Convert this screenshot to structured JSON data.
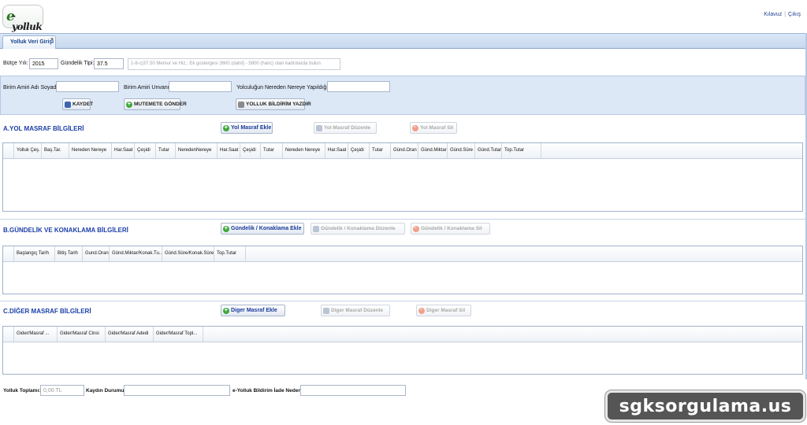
{
  "header": {
    "logo_e": "e",
    "logo_text": "-yolluk",
    "links": [
      "Kılavuz",
      "Çıkış"
    ],
    "link_sep": "|"
  },
  "tab": {
    "label": "Yolluk Veri Girişi",
    "close": "×"
  },
  "form_top": {
    "budget_year_label": "Bütçe Yılı:",
    "budget_year_value": "2015",
    "daily_type_label": "Gündelik Tipi:",
    "daily_type_value": "37.5",
    "info_text": "1-8-c)37.50 Memur ve Hiz.; Ek gostergesi 3600 (dahil) - 5800 (haric) olan kadrolarda bulun"
  },
  "panel": {
    "supervisor_name_label": "Birim Amiri Adı Soyadı:",
    "supervisor_name_value": "",
    "supervisor_title_label": "Birim Amiri Unvanı:",
    "supervisor_title_value": "",
    "route_label": "Yolculuğun Nereden Nereye Yapıldığı:",
    "route_value": "",
    "save_label": "KAYDET",
    "send_label": "MUTEMETE GÖNDER",
    "print_label": "YOLLUK BİLDİRİM YAZDIR"
  },
  "section_a": {
    "title": "A.YOL MASRAF BİLGİLERİ",
    "add_label": "Yol Masraf Ekle",
    "edit_label": "Yol Masraf Düzenle",
    "delete_label": "Yol Masraf Sil",
    "columns": [
      "Yolluk Çeş.",
      "Baş.Tar.",
      "Nereden Nereye",
      "Har.Saat",
      "Çeşidi",
      "Tutar",
      "NeredenNereye",
      "Har.Saat",
      "Çeşidi",
      "Tutar",
      "Nereden Nereye",
      "Har.Saat",
      "Çeşidi",
      "Tutar",
      "Günd.Oran",
      "Günd.Miktar",
      "Günd.Süre",
      "Günd.Tutar",
      "Top.Tutar"
    ]
  },
  "section_b": {
    "title": "B.GÜNDELİK VE KONAKLAMA BİLGİLERİ",
    "add_label": "Gündelik / Konaklama Ekle",
    "edit_label": "Gündelik / Konaklama Düzenle",
    "delete_label": "Gündelik / Konaklama Sil",
    "columns": [
      "Başlangıç Tarih",
      "Bitiş Tarih",
      "Gund.Oran",
      "Günd.Miktar/Konak.Tu...",
      "Günd.Süre/Konak.Süre",
      "Top.Tutar"
    ]
  },
  "section_c": {
    "title": "C.DİĞER MASRAF BİLGİLERİ",
    "add_label": "Diger Masraf Ekle",
    "edit_label": "Diger Masraf Düzenle",
    "delete_label": "Diger Masraf Sil",
    "columns": [
      "Gider/Masraf ...",
      "Gider/Masraf Cinsi",
      "Gider/Masraf Adedi",
      "Gider/Masraf Topl..."
    ]
  },
  "footer": {
    "total_label": "Yolluk Toplamı:",
    "total_value": "0,00 TL",
    "record_status_label": "Kaydın Durumu:",
    "record_status_value": "",
    "return_reason_label": "e-Yolluk Bildirim İade Nedeni:",
    "return_reason_value": ""
  },
  "watermark": "sgksorgulama.us",
  "colors": {
    "accent": "#1b3fa8",
    "panel": "#dde8f7",
    "tabstrip": "#c7d8ef"
  }
}
